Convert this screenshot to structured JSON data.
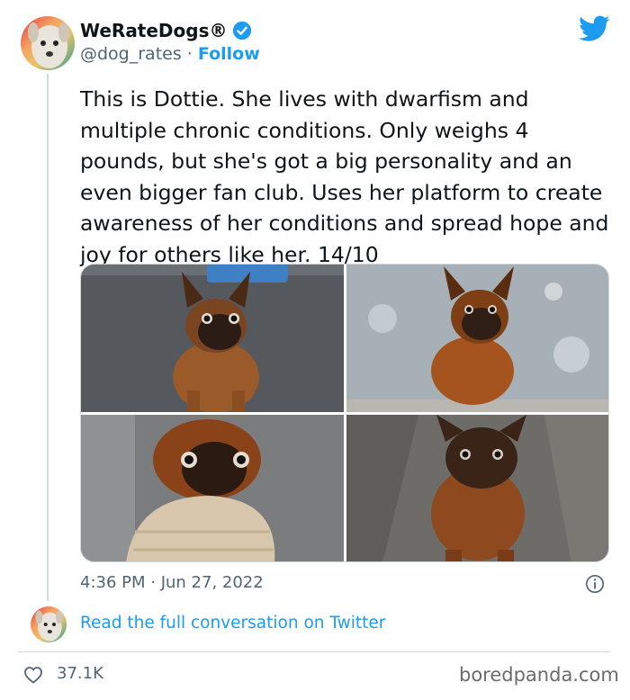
{
  "author": {
    "display_name": "WeRateDogs®",
    "handle": "@dog_rates",
    "separator": " · ",
    "follow_label": "Follow"
  },
  "tweet": {
    "text": "This is Dottie. She lives with dwarfism and multiple chronic conditions. Only weighs 4 pounds, but she's got a big personality and an even bigger fan club. Uses her platform to create awareness of her conditions and spread hope and joy for others like her. 14/10",
    "timestamp": "4:36 PM · Jun 27, 2022"
  },
  "conversation": {
    "link_label": "Read the full conversation on Twitter"
  },
  "engagement": {
    "likes": "37.1K"
  },
  "watermark": "boredpanda.com",
  "icons": {
    "brand": "twitter-bird-icon",
    "verified": "verified-badge-icon",
    "info": "info-icon",
    "like": "heart-icon"
  },
  "colors": {
    "accent": "#1d9bf0",
    "text": "#0f1419",
    "secondary": "#536471",
    "border": "#cfd9de"
  }
}
